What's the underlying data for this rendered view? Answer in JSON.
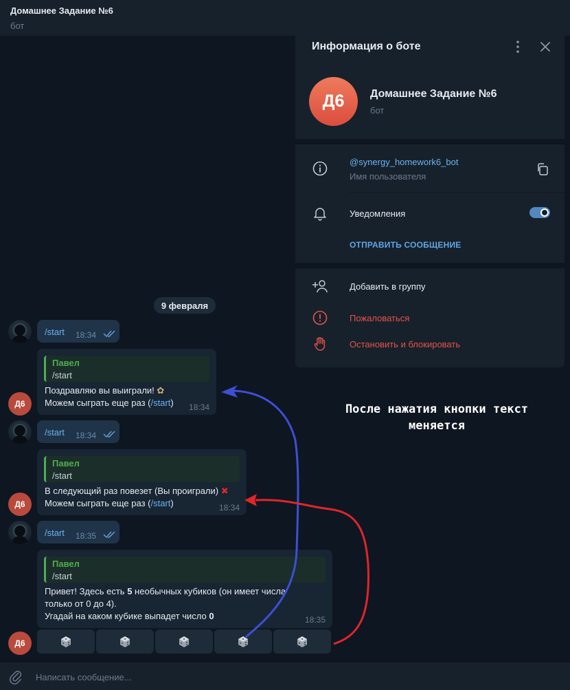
{
  "header": {
    "title": "Домашнее Задание №6",
    "subtitle": "бот"
  },
  "chat": {
    "date": "9 февраля",
    "bot_avatar_initials": "Д6",
    "messages": [
      {
        "type": "outgoing",
        "text": "/start",
        "time": "18:34"
      },
      {
        "type": "incoming",
        "quote_name": "Павел",
        "quote_text": "/start",
        "line1": "Поздравляю вы выиграли!",
        "line1_emoji": "✨",
        "line2_prefix": "Можем сыграть еще раз (",
        "line2_link": "/start",
        "line2_suffix": ")",
        "time": "18:34"
      },
      {
        "type": "outgoing",
        "text": "/start",
        "time": "18:34"
      },
      {
        "type": "incoming",
        "quote_name": "Павел",
        "quote_text": "/start",
        "line1": "В следующий раз повезет (Вы проиграли)",
        "line1_emoji": "❌",
        "line2_prefix": "Можем сыграть еще раз (",
        "line2_link": "/start",
        "line2_suffix": ")",
        "time": "18:34"
      },
      {
        "type": "outgoing",
        "text": "/start",
        "time": "18:35"
      },
      {
        "type": "incoming",
        "quote_name": "Павел",
        "quote_text": "/start",
        "line1_prefix": "Привет! Здесь есть ",
        "line1_bold": "5",
        "line1_suffix": " необычных кубиков (он имеет числа",
        "line2": "только от 0 до 4).",
        "line3_prefix": "Угадай на каком кубике выпадет число ",
        "line3_bold": "0",
        "time": "18:35"
      }
    ],
    "keyboard_buttons": [
      "dice",
      "dice",
      "dice",
      "dice",
      "dice"
    ]
  },
  "input": {
    "placeholder": "Написать сообщение..."
  },
  "annotation": {
    "line1": "После нажатия кнопки текст",
    "line2": "меняется"
  },
  "panel": {
    "title": "Информация о боте",
    "avatar_initials": "Д6",
    "bot_name": "Домашнее Задание №6",
    "bot_type": "бот",
    "username": "@synergy_homework6_bot",
    "username_caption": "Имя пользователя",
    "notifications_label": "Уведомления",
    "notifications_on": true,
    "send_message": "ОТПРАВИТЬ СООБЩЕНИЕ",
    "add_to_group": "Добавить в группу",
    "report": "Пожаловаться",
    "block": "Остановить и блокировать"
  },
  "colors": {
    "background": "#0e1621",
    "panel": "#17212b",
    "accent": "#6ab2f2",
    "quote_green": "#4fae4e",
    "danger": "#e5534b",
    "arrow_blue": "#3d4fd6",
    "arrow_red": "#e0252b"
  }
}
